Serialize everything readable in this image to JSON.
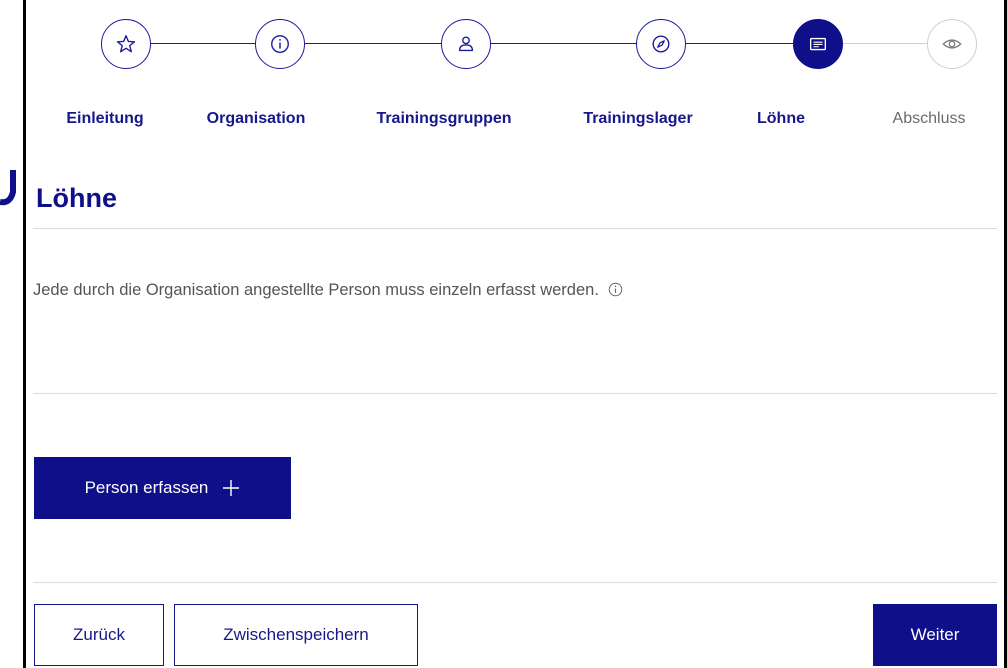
{
  "steps": [
    {
      "label": "Einleitung",
      "icon": "star-icon",
      "state": "done"
    },
    {
      "label": "Organisation",
      "icon": "info-icon",
      "state": "done"
    },
    {
      "label": "Trainingsgruppen",
      "icon": "person-icon",
      "state": "done"
    },
    {
      "label": "Trainingslager",
      "icon": "compass-icon",
      "state": "done"
    },
    {
      "label": "Löhne",
      "icon": "payslip-icon",
      "state": "active"
    },
    {
      "label": "Abschluss",
      "icon": "eye-icon",
      "state": "upcoming"
    }
  ],
  "section": {
    "title": "Löhne",
    "info_text": "Jede durch die Organisation angestellte Person muss einzeln erfasst werden."
  },
  "actions": {
    "add_person": "Person erfassen",
    "back": "Zurück",
    "save_draft": "Zwischenspeichern",
    "next": "Weiter"
  },
  "colors": {
    "primary": "#0f0f8a",
    "divider": "#dcdcdc",
    "upcoming": "#cfcfcf"
  }
}
